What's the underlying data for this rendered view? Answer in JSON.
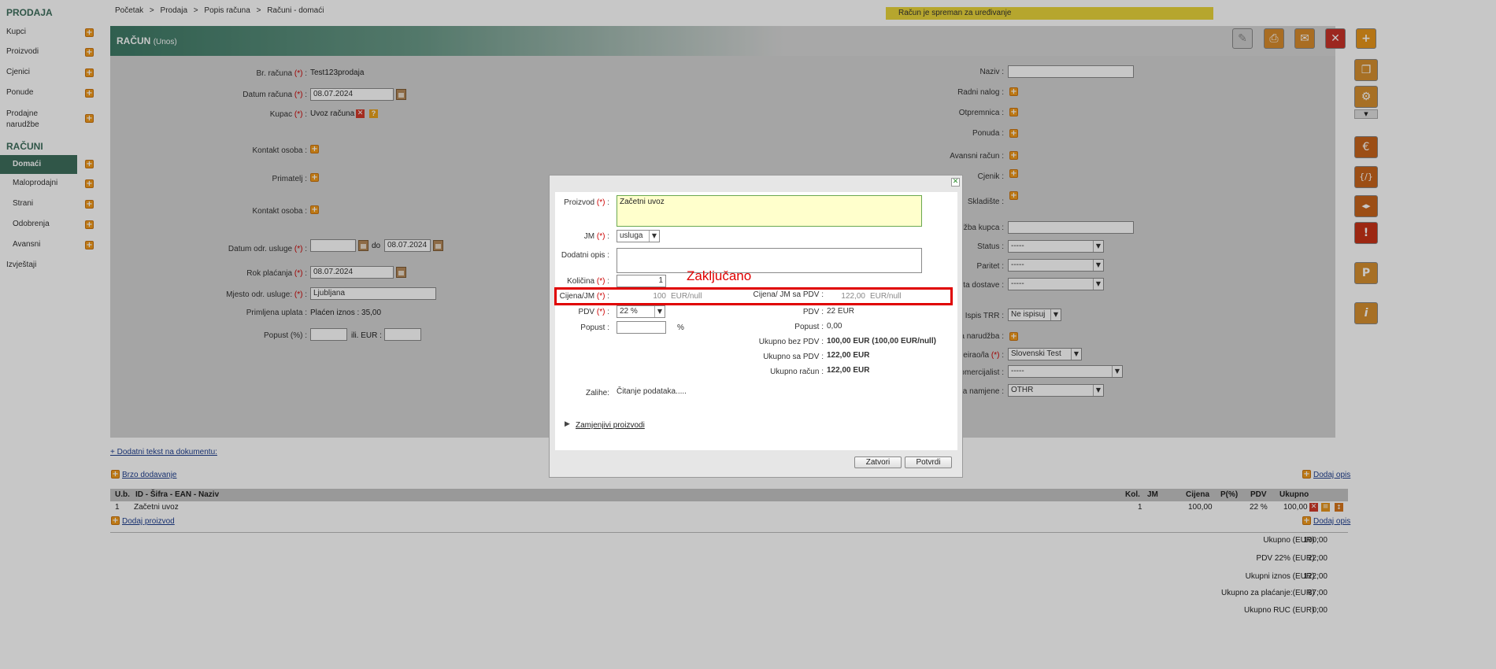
{
  "sidebar": {
    "section_prodaja": "PRODAJA",
    "items": [
      {
        "label": "Kupci"
      },
      {
        "label": "Proizvodi"
      },
      {
        "label": "Cjenici"
      },
      {
        "label": "Ponude"
      },
      {
        "label": "Prodajne"
      },
      {
        "label": "narudžbe"
      }
    ],
    "section_racuni": "RAČUNI",
    "racuni_items": [
      {
        "label": "Domaći"
      },
      {
        "label": "Maloprodajni"
      },
      {
        "label": "Strani"
      },
      {
        "label": "Odobrenja"
      },
      {
        "label": "Avansni"
      }
    ],
    "izvjestaji": "Izvještaji"
  },
  "breadcrumb": {
    "b1": "Početak",
    "sep": ">",
    "b2": "Prodaja",
    "b3": "Popis računa",
    "b4": "Računi - domaći"
  },
  "status_message": "Račun je spreman za uređivanje",
  "header": {
    "title": "RAČUN",
    "subtitle": "(Unos)"
  },
  "toolbar_icons": [
    "pencil-icon",
    "printer-icon",
    "envelope-icon",
    "close-icon",
    "plus-icon"
  ],
  "right_icons": [
    "copy-icon",
    "gear-icon",
    "chevron-down-icon",
    "euro-icon",
    "exchange-icon",
    "code-icon",
    "exclamation-icon",
    "p-icon",
    "info-icon"
  ],
  "form_left": {
    "br_racuna_label": "Br. računa",
    "br_racuna_value": "Test123prodaja",
    "datum_racuna_label": "Datum računa",
    "datum_racuna_value": "08.07.2024",
    "kupac_label": "Kupac",
    "kupac_value": "Uvoz računa",
    "kontakt_osoba_label": "Kontakt osoba :",
    "primatelj_label": "Primatelj :",
    "kontakt_osoba2_label": "Kontakt osoba :",
    "datum_odr_label": "Datum odr. usluge",
    "datum_do": "do",
    "datum_odr_to": "08.07.2024",
    "rok_placanja_label": "Rok plaćanja",
    "rok_placanja_value": "08.07.2024",
    "mjesto_label": "Mjesto odr. usluge:",
    "mjesto_value": "Ljubljana",
    "primljena_label": "Primljena uplata :",
    "primljena_value": "Plaćen iznos : 35,00",
    "popust_label": "Popust (%) :",
    "popust_ili": "ili. EUR :",
    "req": "(*)"
  },
  "form_right": {
    "naziv": "Naziv :",
    "radni_nalog": "Radni nalog :",
    "otpremnica": "Otpremnica :",
    "ponuda": "Ponuda :",
    "avansni_racun": "Avansni račun :",
    "cjenik": "Cjenik :",
    "skladiste": "Skladište :",
    "narudzba_kupca": "džba kupca :",
    "status": "Status :",
    "paritet": "Paritet :",
    "nacin_dostave": "sta dostave :",
    "status_value": "-----",
    "paritet_value": "-----",
    "dostava_value": "-----",
    "ispis_trr": "Ispis TRR :",
    "ispis_trr_value": "Ne ispisuj",
    "narudzba": "a narudžba :",
    "kreirao": "kreirao/la",
    "kreirao_value": "Slovenski Test",
    "komercijalist": "omercijalist :",
    "komercijalist_value": "-----",
    "namjena": "ra namjene :",
    "namjena_value": "OTHR"
  },
  "bottom": {
    "dodatni_tekst": "+ Dodatni tekst na dokumentu:",
    "brzo_dodavanje": "Brzo dodavanje",
    "dodaj_opis": "Dodaj opis",
    "dodaj_proizvod": "Dodaj proizvod",
    "dodaj_opis2": "Dodaj opis",
    "table": {
      "headers": [
        "U.b.",
        "ID - Šifra - EAN - Naziv",
        "Kol.",
        "JM",
        "Cijena",
        "P(%)",
        "PDV",
        "Ukupno"
      ],
      "row": [
        "1",
        "Začetni uvoz",
        "1",
        "",
        "100,00",
        "",
        "22 %",
        "100,00"
      ]
    },
    "totals": [
      {
        "label": "Ukupno (EUR) :",
        "value": "100,00"
      },
      {
        "label": "PDV 22% (EUR) :",
        "value": "22,00"
      },
      {
        "label": "Ukupni iznos (EUR) :",
        "value": "122,00"
      },
      {
        "label": "Ukupno za plaćanje:(EUR) :",
        "value": "87,00"
      },
      {
        "label": "Ukupno RUC (EUR) :",
        "value": "0,00"
      }
    ]
  },
  "modal": {
    "proizvod_label": "Proizvod",
    "proizvod_value": "Začetni uvoz",
    "jm_label": "JM",
    "jm_value": "usluga",
    "dodatni_opis_label": "Dodatni opis :",
    "kolicina_label": "Količina",
    "kolicina_value": "1",
    "cijena_label": "Cijena/JM",
    "cijena_value": "100",
    "cijena_unit": "EUR/null",
    "cijena_pdv_label": "Cijena/ JM sa PDV :",
    "cijena_pdv_value": "122,00",
    "cijena_pdv_unit": "EUR/null",
    "pdv_label": "PDV",
    "pdv_value": "22 %",
    "popust_label": "Popust :",
    "popust_unit": "%",
    "pdv_r_label": "PDV :",
    "pdv_r_value": "22 EUR",
    "popust_r_label": "Popust :",
    "popust_r_value": "0,00",
    "ukupno_bez_label": "Ukupno bez PDV :",
    "ukupno_bez_value": "100,00 EUR (100,00 EUR/null)",
    "ukupno_sa_label": "Ukupno sa PDV :",
    "ukupno_sa_value": "122,00 EUR",
    "ukupno_racun_label": "Ukupno račun :",
    "ukupno_racun_value": "122,00 EUR",
    "zalihe_label": "Zalihe:",
    "zalihe_value": "Čitanje podataka.....",
    "zamjenjivi": "Zamjenjivi proizvodi",
    "zatvori": "Zatvori",
    "potvrdi": "Potvrdi",
    "req": "(*)",
    "colon": ":"
  },
  "annotation": {
    "text": "Zaključano",
    "color": "#e00000"
  }
}
